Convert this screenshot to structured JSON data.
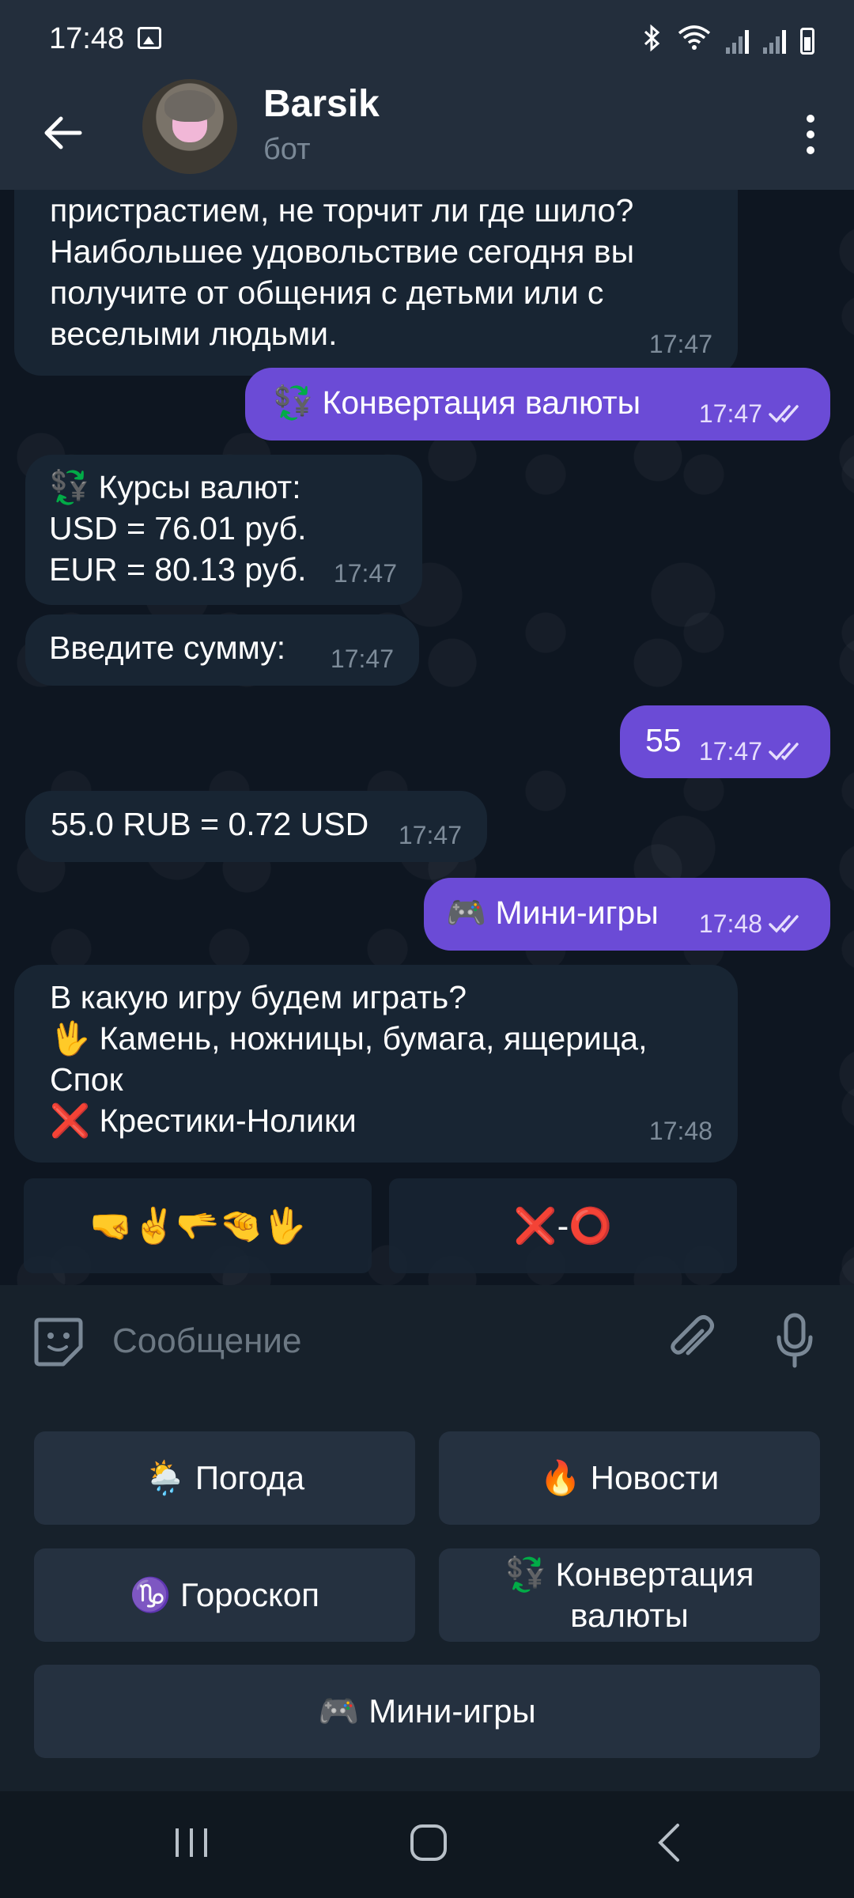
{
  "status_bar": {
    "time": "17:48"
  },
  "header": {
    "title": "Barsik",
    "subtitle": "бот"
  },
  "messages": [
    {
      "dir": "in",
      "text": "пристрастием, не торчит ли где шило?\nНаибольшее удовольствие сегодня вы\nполучите от общения с детьми или с\nвеселыми людьми.",
      "time": "17:47"
    },
    {
      "dir": "out",
      "text": "💱 Конвертация валюты",
      "time": "17:47"
    },
    {
      "dir": "in",
      "text": "💱 Курсы валют:\nUSD = 76.01 руб.\nEUR = 80.13 руб.",
      "time": "17:47"
    },
    {
      "dir": "in",
      "text": "Введите сумму:",
      "time": "17:47"
    },
    {
      "dir": "out",
      "text": "55",
      "time": "17:47"
    },
    {
      "dir": "in",
      "text": "55.0 RUB = 0.72 USD",
      "time": "17:47"
    },
    {
      "dir": "out",
      "text": "🎮 Мини-игры",
      "time": "17:48"
    },
    {
      "dir": "in",
      "text": "В какую игру будем играть?\n🖖 Камень, ножницы, бумага, ящерица,\nСпок\n❌ Крестики-Нолики",
      "time": "17:48"
    }
  ],
  "inline_keyboard": [
    {
      "label": "🤜✌️🫳🤏🖖"
    },
    {
      "label": "❌-⭕"
    }
  ],
  "input": {
    "placeholder": "Сообщение",
    "value": ""
  },
  "reply_keyboard": [
    {
      "label": "🌦️ Погода"
    },
    {
      "label": "🔥 Новости"
    },
    {
      "label": "♑ Гороскоп"
    },
    {
      "label": "💱 Конвертация\nвалюты"
    },
    {
      "label": "🎮 Мини-игры"
    }
  ],
  "colors": {
    "accent": "#6b4bd6",
    "incoming_bubble": "#182533",
    "header": "#232e3c",
    "background": "#0e1621"
  }
}
